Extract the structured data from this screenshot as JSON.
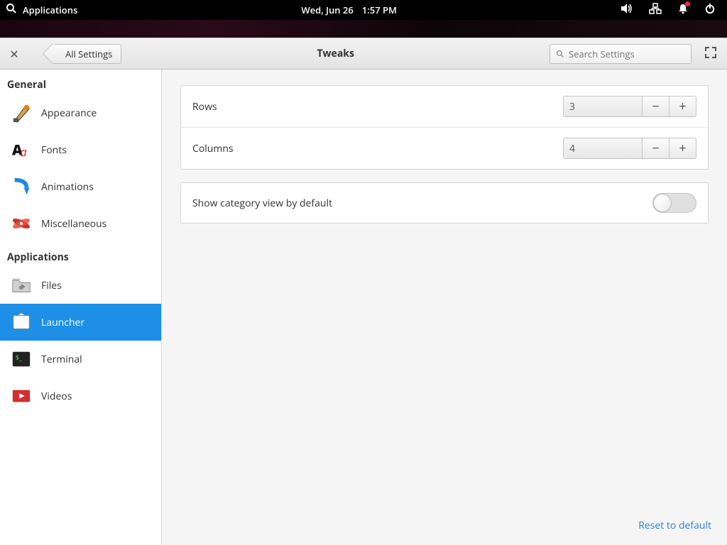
{
  "sysbar": {
    "apps_label": "Applications",
    "date": "Wed, Jun 26",
    "time": "1:57 PM"
  },
  "header": {
    "back_label": "All Settings",
    "title": "Tweaks",
    "search_placeholder": "Search Settings"
  },
  "sidebar": {
    "groups": [
      {
        "title": "General",
        "items": [
          {
            "label": "Appearance",
            "key": "appearance"
          },
          {
            "label": "Fonts",
            "key": "fonts"
          },
          {
            "label": "Animations",
            "key": "animations"
          },
          {
            "label": "Miscellaneous",
            "key": "miscellaneous"
          }
        ]
      },
      {
        "title": "Applications",
        "items": [
          {
            "label": "Files",
            "key": "files"
          },
          {
            "label": "Launcher",
            "key": "launcher"
          },
          {
            "label": "Terminal",
            "key": "terminal"
          },
          {
            "label": "Videos",
            "key": "videos"
          }
        ]
      }
    ],
    "active": "launcher"
  },
  "settings": {
    "rows_label": "Rows",
    "rows_value": "3",
    "cols_label": "Columns",
    "cols_value": "4",
    "show_category_label": "Show category view by default",
    "show_category_on": false
  },
  "reset_label": "Reset to default"
}
